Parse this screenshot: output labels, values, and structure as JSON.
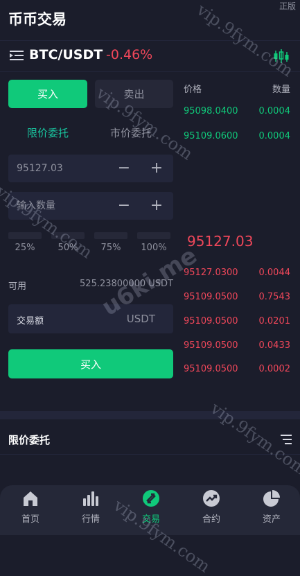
{
  "header": {
    "title": "币币交易",
    "corner_tag": "正版"
  },
  "pair": {
    "menu_icon": "menu-list-icon",
    "name": "BTC/USDT",
    "change": "-0.46%",
    "chart_icon": "candlestick-chart-icon"
  },
  "trade": {
    "buy_tab": "买入",
    "sell_tab": "卖出",
    "order_types": [
      "限价委托",
      "市价委托"
    ],
    "price_value": "95127.03",
    "quantity_placeholder": "输入数量",
    "minus": "−",
    "plus": "+",
    "percent_options": [
      "25%",
      "50%",
      "75%",
      "100%"
    ],
    "available_label": "可用",
    "available_value": "525.23800000 USDT",
    "amount_label": "交易额",
    "amount_unit": "USDT",
    "submit_label": "买入"
  },
  "orderbook": {
    "price_header": "价格",
    "qty_header": "数量",
    "bids": [
      {
        "price": "95098.0400",
        "qty": "0.0004"
      },
      {
        "price": "95109.0600",
        "qty": "0.0004"
      }
    ],
    "last_price": "95127.03",
    "asks": [
      {
        "price": "95127.0300",
        "qty": "0.0044"
      },
      {
        "price": "95109.0500",
        "qty": "0.7543"
      },
      {
        "price": "95109.0500",
        "qty": "0.0201"
      },
      {
        "price": "95109.0500",
        "qty": "0.0433"
      },
      {
        "price": "95109.0500",
        "qty": "0.0002"
      }
    ]
  },
  "orders": {
    "title": "限价委托",
    "list_icon": "list-icon"
  },
  "nav": {
    "items": [
      {
        "label": "首页",
        "icon": "home-icon"
      },
      {
        "label": "行情",
        "icon": "market-bars-icon"
      },
      {
        "label": "交易",
        "icon": "trade-icon"
      },
      {
        "label": "合约",
        "icon": "contract-trend-icon"
      },
      {
        "label": "资产",
        "icon": "assets-pie-icon"
      }
    ]
  },
  "watermarks": {
    "site": "vip.9fym.com",
    "brand": "u6ki.me"
  },
  "colors": {
    "background": "#1b1d2b",
    "buy_green": "#10c97a",
    "sell_red": "#f0475a",
    "accent_teal": "#19c6a0"
  }
}
